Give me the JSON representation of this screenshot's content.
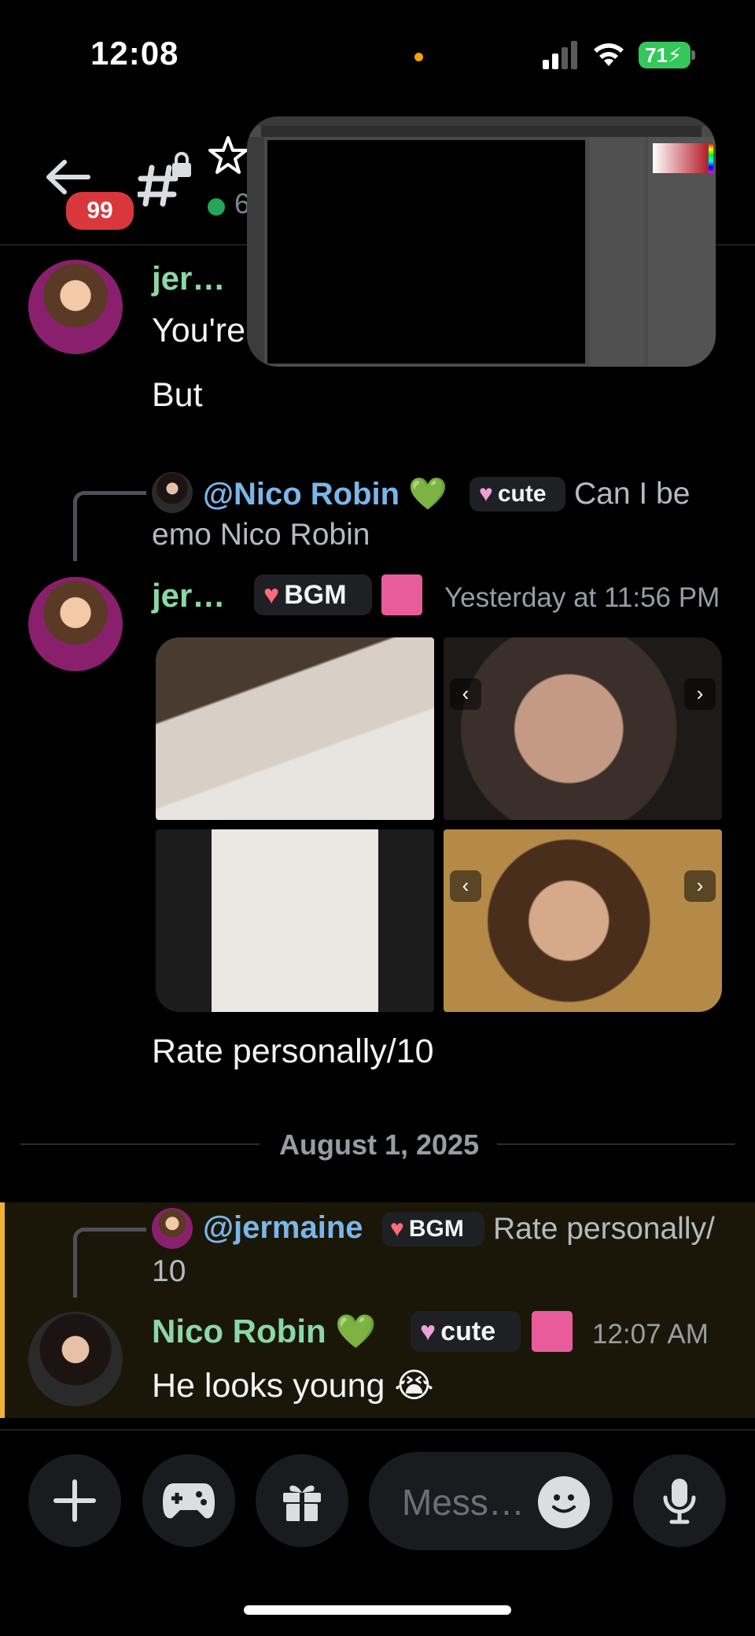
{
  "status_bar": {
    "time": "12:08",
    "battery": "71"
  },
  "header": {
    "unread_badge": "99",
    "subtitle_partial": "6"
  },
  "messages": [
    {
      "author": "jer…",
      "lines": [
        "You're",
        "But"
      ]
    },
    {
      "reply_to": {
        "mention": "@Nico Robin 💚",
        "tag": "cute",
        "text_line1": "Can I be",
        "text_line2": "emo Nico Robin"
      },
      "author": "jer…",
      "tag": "BGM",
      "timestamp": "Yesterday at 11:56 PM",
      "text": "Rate personally/10"
    }
  ],
  "date_divider": "August 1, 2025",
  "highlighted_message": {
    "reply_to": {
      "mention": "@jermaine",
      "tag": "BGM",
      "text_line1": "Rate personally/",
      "text_line2": "10"
    },
    "author": "Nico Robin 💚",
    "tag": "cute",
    "timestamp": "12:07 AM",
    "text": "He looks young 😭"
  },
  "composer": {
    "placeholder": "Mess…"
  },
  "icons": {
    "back": "back-arrow-icon",
    "channel": "hash-lock-icon",
    "star": "star-icon",
    "add": "plus-icon",
    "apps": "gamepad-icon",
    "gift": "gift-icon",
    "emoji": "emoji-icon",
    "mic": "microphone-icon"
  },
  "colors": {
    "accent_green": "#8bd8a5",
    "mention_blue": "#7ab6ea",
    "badge_red": "#da373c",
    "highlight_yellow": "#f0b232",
    "online_green": "#23a55a"
  }
}
